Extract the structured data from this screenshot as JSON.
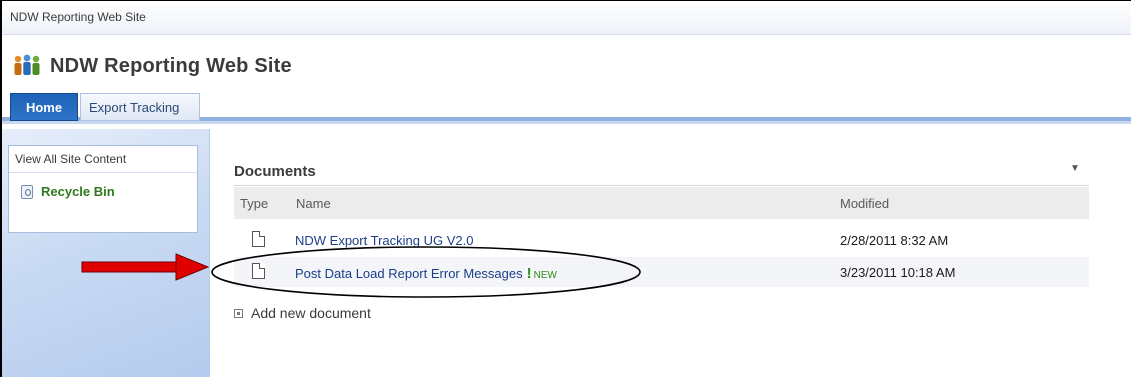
{
  "browser": {
    "title": "NDW Reporting Web Site"
  },
  "site": {
    "title": "NDW Reporting Web Site",
    "logo_icon": "people-logo-icon"
  },
  "nav": {
    "tabs": [
      {
        "label": "Home"
      },
      {
        "label": "Export Tracking"
      }
    ]
  },
  "quick_launch": {
    "view_all": "View All Site Content",
    "recycle_bin": "Recycle Bin",
    "recycle_icon": "recycle-bin-icon"
  },
  "documents": {
    "title": "Documents",
    "menu_glyph": "▼",
    "columns": {
      "type": "Type",
      "name": "Name",
      "modified": "Modified"
    },
    "rows": [
      {
        "name": "NDW Export Tracking UG V2.0",
        "modified": "2/28/2011 8:32 AM",
        "is_new": false
      },
      {
        "name": "Post Data Load Report Error Messages",
        "modified": "3/23/2011 10:18 AM",
        "is_new": true,
        "new_mark": "!",
        "new_label": "NEW"
      }
    ],
    "add_new": "Add new document"
  },
  "annotations": {
    "arrow_color": "#e00000",
    "ellipse_color": "#000000"
  }
}
